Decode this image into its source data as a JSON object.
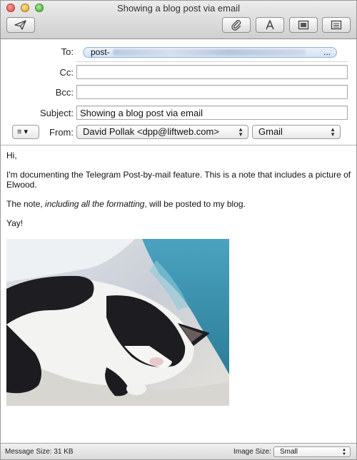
{
  "window": {
    "title": "Showing a blog post via email"
  },
  "toolbar": {
    "send_icon": "paper-plane-icon",
    "attach_icon": "paperclip-icon",
    "format_icon": "letter-a-icon",
    "photo_icon": "photo-browser-icon",
    "stationery_icon": "stationery-icon"
  },
  "headers": {
    "to_label": "To:",
    "to_token": "post-",
    "to_token_ellipsis": "...",
    "cc_label": "Cc:",
    "cc_value": "",
    "bcc_label": "Bcc:",
    "bcc_value": "",
    "subject_label": "Subject:",
    "subject_value": "Showing a blog post via email",
    "list_menu_glyph": "≡ ▾",
    "from_label": "From:",
    "from_value": "David Pollak <dpp@liftweb.com>",
    "account_value": "Gmail"
  },
  "body": {
    "greeting": "Hi,",
    "para1": "I'm documenting the Telegram Post-by-mail feature.  This is a note that includes a picture of Elwood.",
    "para2_before": "The note, ",
    "para2_italic": "including all the formatting",
    "para2_after": ", will be posted to my blog.",
    "closing": "Yay!"
  },
  "footer": {
    "message_size": "Message Size: 31 KB",
    "image_size_label": "Image Size:",
    "image_size_value": "Small"
  },
  "colors": {
    "token_border": "#8fb2dd",
    "toolbar_bg": "#d8d8d8"
  }
}
